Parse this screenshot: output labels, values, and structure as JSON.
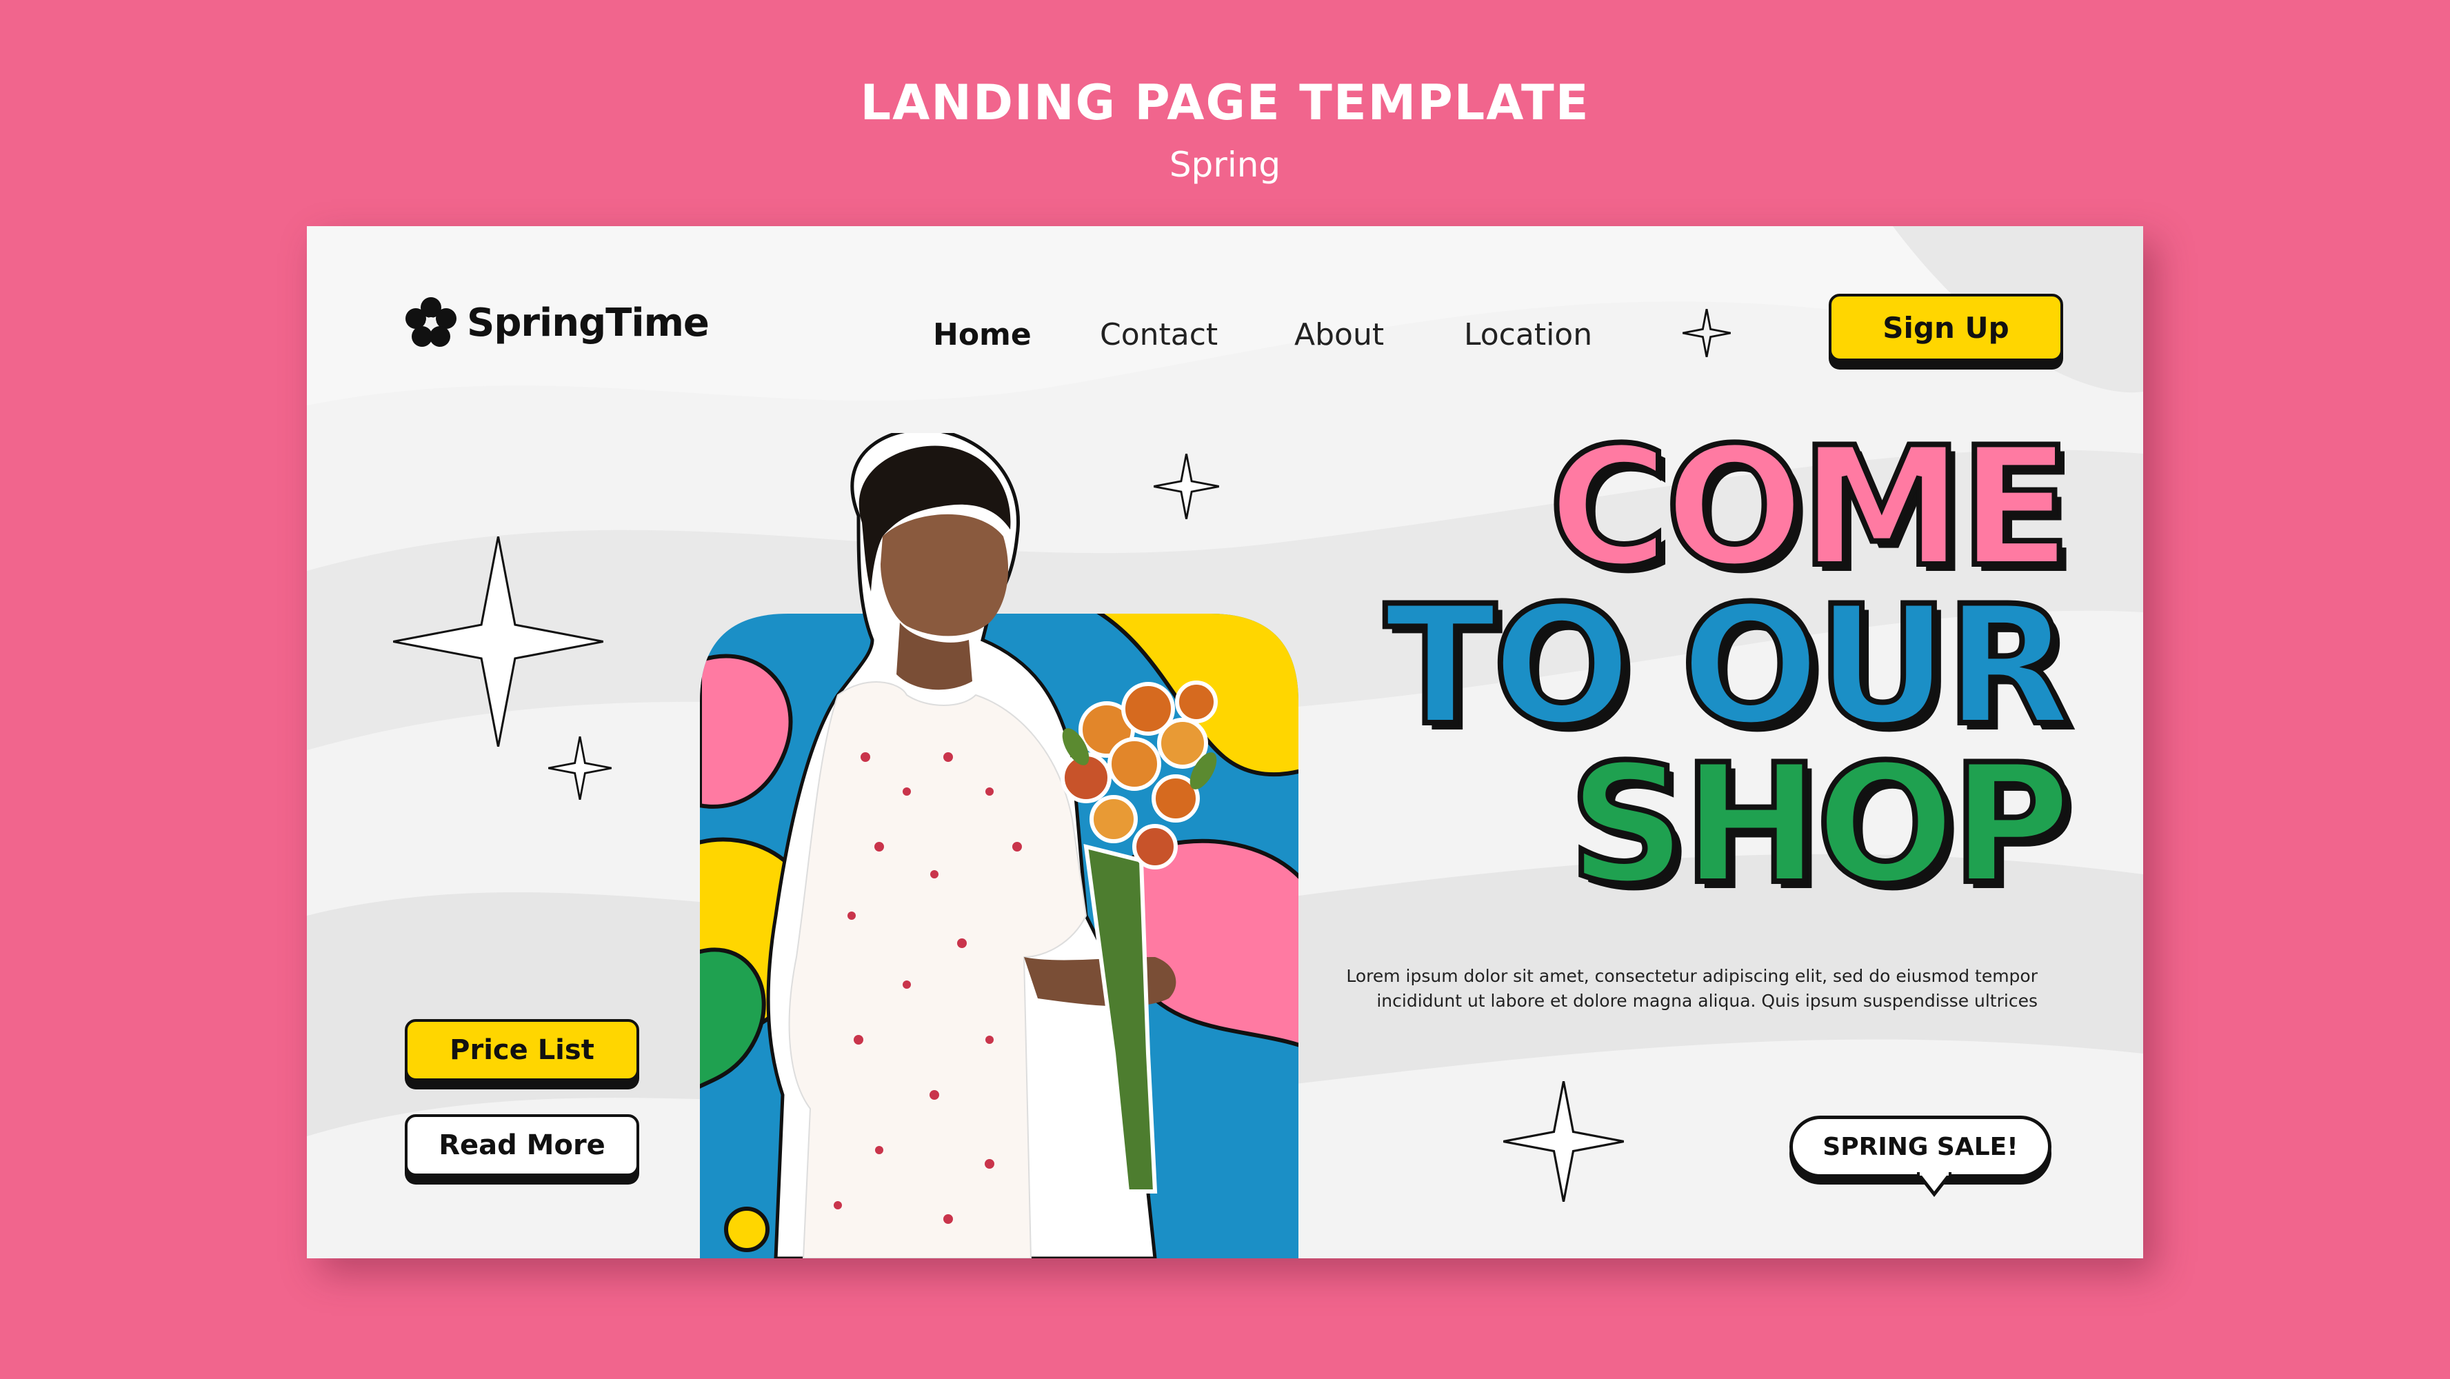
{
  "page_header": {
    "title": "LANDING PAGE TEMPLATE",
    "subtitle": "Spring"
  },
  "nav": {
    "logo_text": "SpringTime",
    "links": [
      "Home",
      "Contact",
      "About",
      "Location"
    ],
    "active": "Home",
    "signup_label": "Sign Up"
  },
  "hero": {
    "lines": [
      "COME",
      "TO OUR",
      "SHOP"
    ],
    "line_colors": [
      "#ff7aa2",
      "#1b8fc6",
      "#1fa150"
    ],
    "description_lines": [
      "Lorem ipsum dolor sit amet, consectetur adipiscing elit, sed do eiusmod tempor",
      "incididunt ut labore et dolore magna aliqua. Quis ipsum suspendisse ultrices"
    ],
    "price_list_label": "Price List",
    "read_more_label": "Read More",
    "sale_label": "SPRING SALE!"
  },
  "colors": {
    "background": "#f1658d",
    "card": "#f3f3f3",
    "button_yellow": "#ffd600",
    "pink": "#ff7aa2",
    "blue": "#1b8fc6",
    "green": "#1fa150"
  }
}
